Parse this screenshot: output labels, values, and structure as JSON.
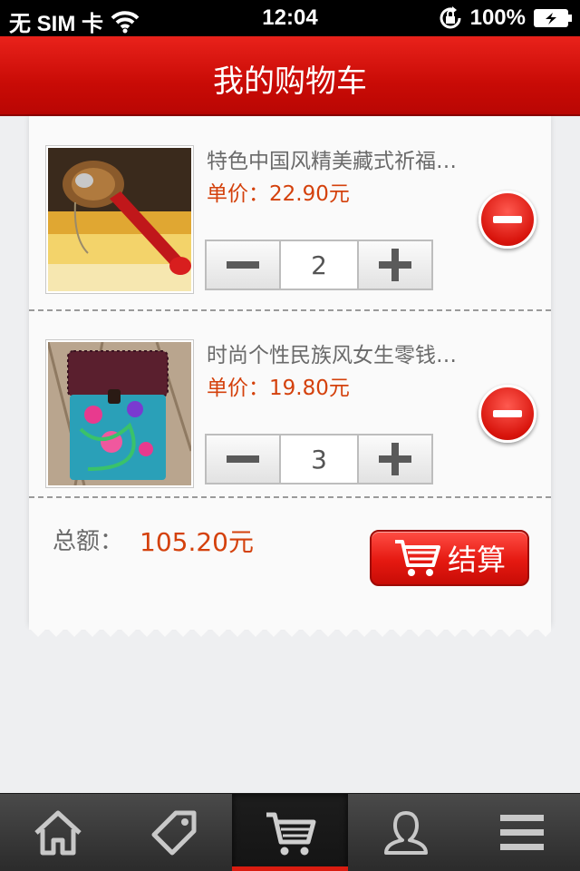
{
  "status_bar": {
    "carrier": "无 SIM 卡",
    "time": "12:04",
    "battery": "100%"
  },
  "header": {
    "title": "我的购物车"
  },
  "cart": {
    "items": [
      {
        "name": "特色中国风精美藏式祈福…",
        "price_label": "单价：",
        "price": "22.90元",
        "quantity": "2"
      },
      {
        "name": "时尚个性民族风女生零钱…",
        "price_label": "单价：",
        "price": "19.80元",
        "quantity": "3"
      }
    ],
    "total_label": "总额：",
    "total_value": "105.20元",
    "checkout_label": "结算"
  },
  "tab_bar": {
    "tabs": [
      {
        "icon": "home-icon"
      },
      {
        "icon": "tag-icon"
      },
      {
        "icon": "cart-icon",
        "active": true
      },
      {
        "icon": "user-icon"
      },
      {
        "icon": "menu-icon"
      }
    ]
  },
  "colors": {
    "brand_red": "#d0100a",
    "price_orange": "#d4410c"
  }
}
